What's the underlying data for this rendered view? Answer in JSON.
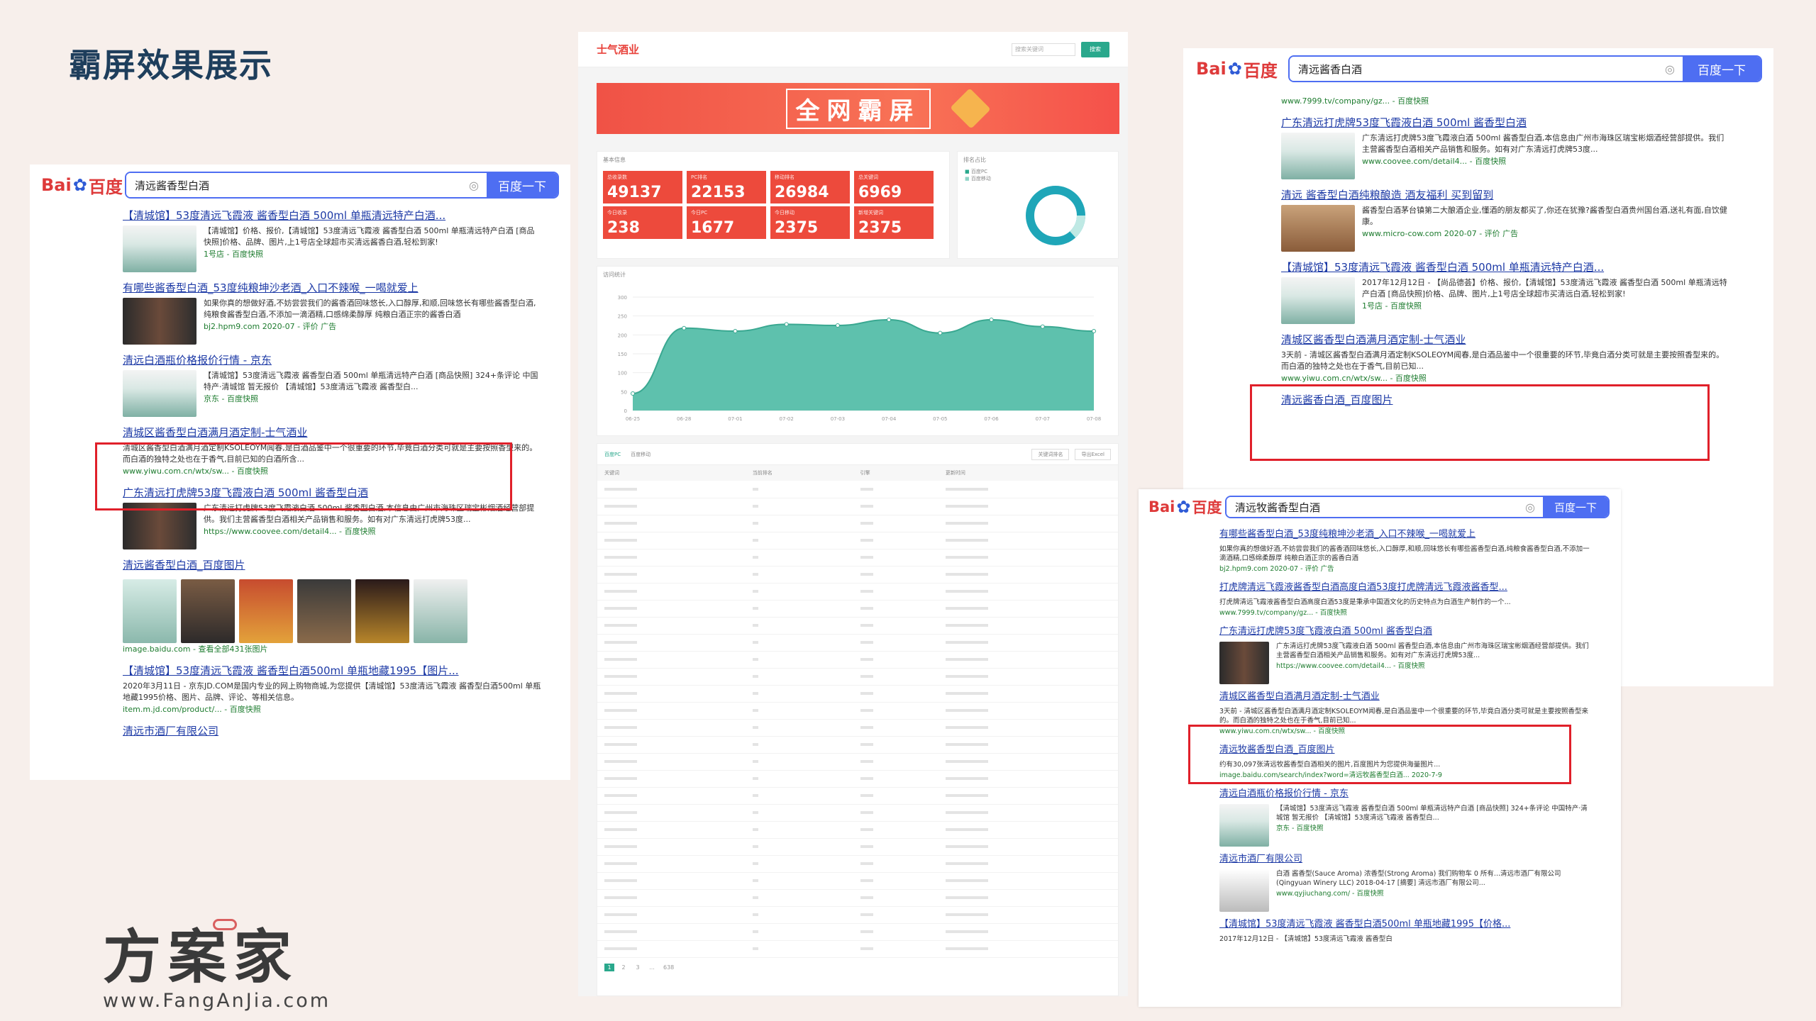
{
  "slide": {
    "title": "霸屏效果展示"
  },
  "brand": {
    "name": "方案家",
    "url": "www.FangAnJia.com"
  },
  "baidu": {
    "logo_left": "Bai",
    "logo_right": "百度",
    "search_button": "百度一下",
    "snapshot": "百度快照"
  },
  "left_panel": {
    "query": "清远酱香型白酒",
    "results": [
      {
        "title": "【清城馆】53度清远飞霞液 酱香型白酒 500ml 单瓶清远特产白酒...",
        "desc": "【清城馆】价格、报价,【清城馆】53度清远飞霞液 酱香型白酒 500ml 单瓶清远特产白酒 [商品快照]价格、品牌、图片,上1号店全球超市买清远酱香白酒,轻松到家!",
        "url": "1号店 - 百度快照"
      },
      {
        "title": "有哪些酱香型白酒_53度纯粮坤沙老酒_入口不辣喉_一喝就爱上",
        "desc": "如果你真的想做好酒,不妨尝尝我们的酱香酒回味悠长,入口醇厚,和顺,回味悠长有哪些酱香型白酒,纯粮食酱香型白酒,不添加一滴酒精,口感绵柔醇厚 纯粮白酒正宗的酱香白酒",
        "url": "bj2.hpm9.com 2020-07 - 评价 广告"
      },
      {
        "title": "清远白酒瓶价格报价行情 - 京东",
        "desc": "【清城馆】53度清远飞霞液 酱香型白酒 500ml 单瓶清远特产白酒 [商品快照] 324+条评论 中国特产·清城馆 暂无报价 【清城馆】53度清远飞霞液 酱香型白...",
        "url": "京东 - 百度快照"
      },
      {
        "title": "清城区酱香型白酒满月酒定制-士气酒业",
        "desc": "清城区酱香型白酒满月酒定制KSOLEOYM闻春,是白酒品鉴中一个很重要的环节,毕竟白酒分类可就是主要按照香型来的。而白酒的独特之处也在于香气,目前已知的白酒所含...",
        "url": "www.yiwu.com.cn/wtx/sw... - 百度快照"
      },
      {
        "title": "广东清远打虎牌53度飞霞液白酒 500ml 酱香型白酒",
        "desc": "广东清远打虎牌53度飞霞液白酒 500ml 酱香型白酒,本信息由广州市海珠区瑞宝彬烟酒经营部提供。我们主营酱香型白酒相关产品销售和服务。如有对广东清远打虎牌53度...",
        "url": "https://www.coovee.com/detail4... - 百度快照"
      },
      {
        "title": "清远酱香型白酒_百度图片",
        "desc": "",
        "url": "image.baidu.com - 查看全部431张图片"
      },
      {
        "title": "【清城馆】53度清远飞霞液 酱香型白酒500ml 单瓶地藏1995【图片...",
        "desc": "2020年3月11日 - 京东JD.COM是国内专业的网上购物商城,为您提供【清城馆】53度清远飞霞液 酱香型白酒500ml 单瓶地藏1995价格、图片、品牌、评论、等相关信息。",
        "url": "item.m.jd.com/product/... - 百度快照"
      },
      {
        "title": "清远市酒厂有限公司",
        "desc": "",
        "url": ""
      }
    ]
  },
  "dashboard": {
    "logo": "士气酒业",
    "search_placeholder": "搜索关键词",
    "search_btn": "搜索",
    "banner": "全网霸屏",
    "basic_label": "基本信息",
    "stats": [
      {
        "label": "总收录数",
        "value": "49137"
      },
      {
        "label": "PC排名",
        "value": "22153"
      },
      {
        "label": "移动排名",
        "value": "26984"
      },
      {
        "label": "总关键词",
        "value": "6969"
      },
      {
        "label": "今日收录",
        "value": "238"
      },
      {
        "label": "今日PC",
        "value": "1677"
      },
      {
        "label": "今日移动",
        "value": "2375"
      },
      {
        "label": "新增关键词",
        "value": "2375"
      }
    ],
    "pie_label": "排名占比",
    "pie_legend": [
      "百度PC",
      "百度移动"
    ],
    "chart_label": "访问统计",
    "table_tabs": [
      "百度PC",
      "百度移动"
    ],
    "table_buttons": [
      "关键词排名",
      "导出Excel"
    ],
    "table_headers": [
      "关键词",
      "当前排名",
      "引擎",
      "更新时间"
    ],
    "pager": [
      "1",
      "2",
      "3",
      "...",
      "638"
    ]
  },
  "chart_data": {
    "type": "area",
    "title": "",
    "xlabel": "",
    "ylabel": "",
    "x": [
      "06-25",
      "06-28",
      "07-01",
      "07-02",
      "07-03",
      "07-04",
      "07-05",
      "07-06",
      "07-07",
      "07-08"
    ],
    "series": [
      {
        "values": [
          45,
          218,
          210,
          228,
          225,
          240,
          205,
          240,
          222,
          210
        ]
      }
    ],
    "ylim": [
      0,
      300
    ],
    "yticks": [
      "300",
      "250",
      "200",
      "150",
      "100",
      "50",
      "0"
    ],
    "colors": {
      "fill": "#5ec1ad",
      "line": "#3aa891"
    }
  },
  "right_top_panel": {
    "query": "清远酱香白酒",
    "results": [
      {
        "title": "",
        "desc": "",
        "url": "www.7999.tv/company/gz... - 百度快照"
      },
      {
        "title": "广东清远打虎牌53度飞霞液白酒 500ml 酱香型白酒",
        "desc": "广东清远打虎牌53度飞霞液白酒 500ml 酱香型白酒,本信息由广州市海珠区瑞宝彬烟酒经营部提供。我们主营酱香型白酒相关产品销售和服务。如有对广东清远打虎牌53度...",
        "url": "www.coovee.com/detail4... - 百度快照"
      },
      {
        "title": "清远 酱香型白酒纯粮酿造 酒友福利 买到留到",
        "desc": "酱香型白酒茅台镇第二大酿酒企业,懂酒的朋友都买了,你还在犹豫?酱香型白酒贵州国台酒,送礼有面,自饮健康。",
        "url": "www.micro-cow.com 2020-07 - 评价 广告"
      },
      {
        "title": "【清城馆】53度清远飞霞液 酱香型白酒 500ml 单瓶清远特产白酒...",
        "desc": "2017年12月12日 - 【尚品德荟】价格、报价,【清城馆】53度清远飞霞液 酱香型白酒 500ml 单瓶清远特产白酒 [商品快照]价格、品牌、图片,上1号店全球超市买清远白酒,轻松到家!",
        "url": "1号店 - 百度快照"
      },
      {
        "title": "清城区酱香型白酒满月酒定制-士气酒业",
        "desc": "3天前 - 清城区酱香型白酒满月酒定制KSOLEOYM闻春,是白酒品鉴中一个很重要的环节,毕竟白酒分类可就是主要按照香型来的。而白酒的独特之处也在于香气,目前已知...",
        "url": "www.yiwu.com.cn/wtx/sw... - 百度快照"
      },
      {
        "title": "清远酱香白酒_百度图片",
        "desc": "",
        "url": ""
      }
    ]
  },
  "right_bottom_panel": {
    "query": "清远牧酱香型白酒",
    "results": [
      {
        "title": "有哪些酱香型白酒_53度纯粮坤沙老酒_入口不辣喉_一喝就爱上",
        "desc": "如果你真的想做好酒,不妨尝尝我们的酱香酒回味悠长,入口醇厚,和顺,回味悠长有哪些酱香型白酒,纯粮食酱香型白酒,不添加一滴酒精,口感绵柔醇厚 纯粮白酒正宗的酱香白酒",
        "url": "bj2.hpm9.com 2020-07 - 评价 广告"
      },
      {
        "title": "打虎牌清远飞霞液酱香型白酒高度白酒53度打虎牌清远飞霞液酱香型...",
        "desc": "打虎牌清远飞霞液酱香型白酒高度白酒53度是秉承中国酒文化的历史特点为白酒生产制作的一个...",
        "url": "www.7999.tv/company/gz... - 百度快照"
      },
      {
        "title": "广东清远打虎牌53度飞霞液白酒 500ml 酱香型白酒",
        "desc": "广东清远打虎牌53度飞霞液白酒 500ml 酱香型白酒,本信息由广州市海珠区瑞宝彬烟酒经营部提供。我们主营酱香型白酒相关产品销售和服务。如有对广东清远打虎牌53度...",
        "url": "https://www.coovee.com/detail4... - 百度快照"
      },
      {
        "title": "清城区酱香型白酒满月酒定制-士气酒业",
        "desc": "3天前 - 清城区酱香型白酒满月酒定制KSOLEOYM闻春,是白酒品鉴中一个很重要的环节,毕竟白酒分类可就是主要按照香型来的。而白酒的独特之处也在于香气,目前已知...",
        "url": "www.yiwu.com.cn/wtx/sw... - 百度快照"
      },
      {
        "title": "清远牧酱香型白酒_百度图片",
        "desc": "约有30,097张清远牧酱香型白酒相关的图片,百度图片为您提供海量图片...",
        "url": "image.baidu.com/search/index?word=清远牧酱香型白酒... 2020-7-9"
      },
      {
        "title": "清远白酒瓶价格报价行情 - 京东",
        "desc": "【清城馆】53度清远飞霞液 酱香型白酒 500ml 单瓶清远特产白酒 [商品快照] 324+条评论 中国特产·清城馆 暂无报价 【清城馆】53度清远飞霞液 酱香型白...",
        "url": "京东 - 百度快照"
      },
      {
        "title": "清远市酒厂有限公司",
        "desc": "白酒 酱香型(Sauce Aroma) 浓香型(Strong Aroma) 我们购物车 0 所有...清远市酒厂有限公司(Qingyuan Winery LLC) 2018-04-17 [摘要] 清远市酒厂有限公司...",
        "url": "www.qyjiuchang.com/ - 百度快照"
      },
      {
        "title": "【清城馆】53度清远飞霞液 酱香型白酒500ml 单瓶地藏1995【价格...",
        "desc": "2017年12月12日 - 【清城馆】53度清远飞霞液 酱香型白",
        "url": ""
      }
    ]
  }
}
